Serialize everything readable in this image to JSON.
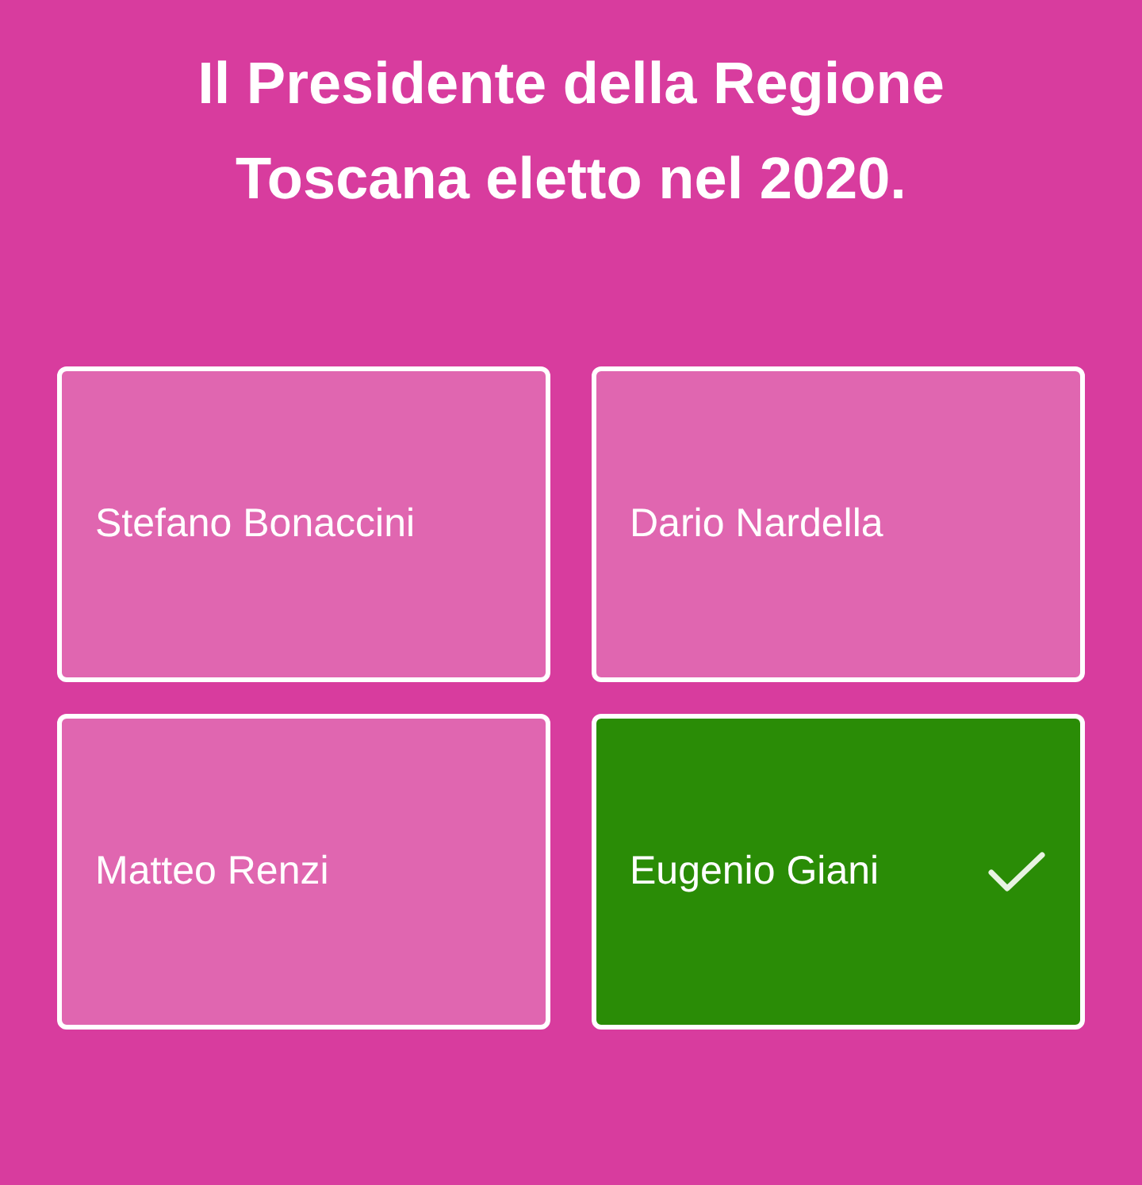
{
  "question": "Il Presidente della Regione Toscana eletto nel 2020.",
  "answers": [
    {
      "label": "Stefano Bonaccini",
      "selected": false
    },
    {
      "label": "Dario Nardella",
      "selected": false
    },
    {
      "label": "Matteo Renzi",
      "selected": false
    },
    {
      "label": "Eugenio Giani",
      "selected": true
    }
  ]
}
